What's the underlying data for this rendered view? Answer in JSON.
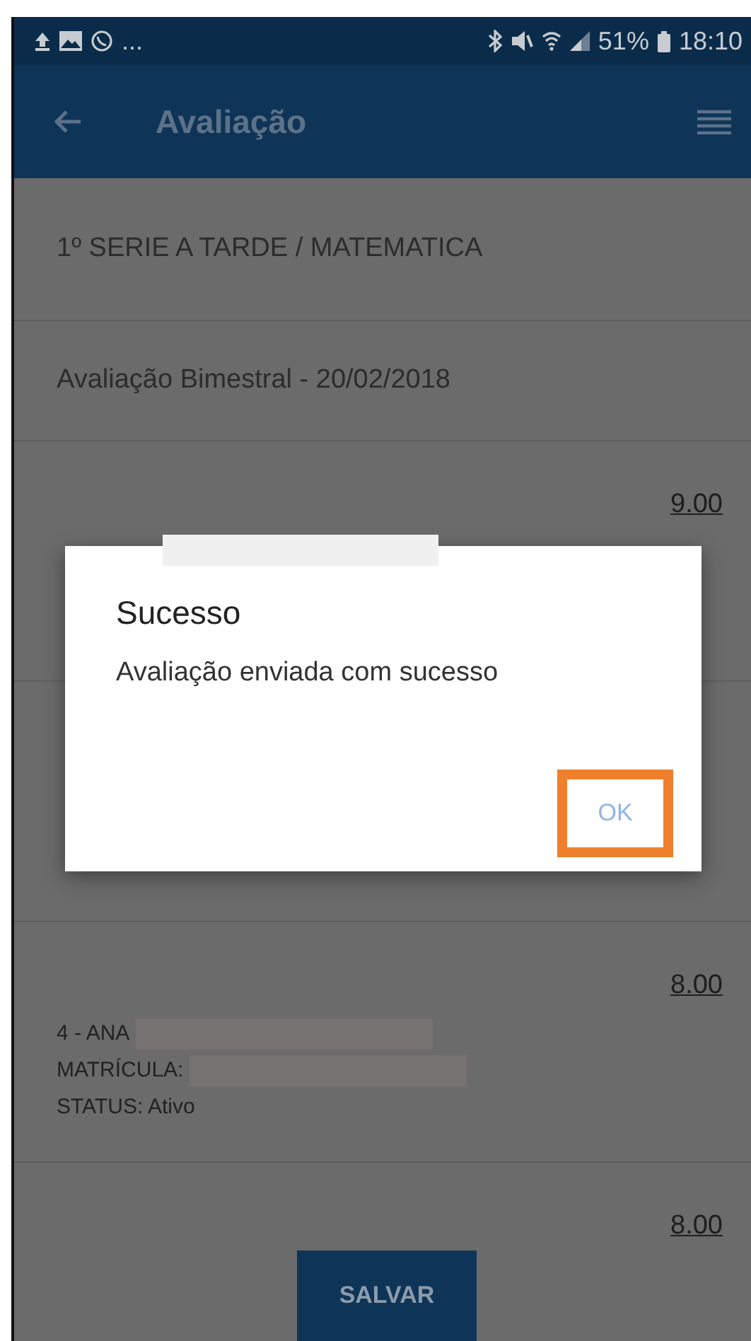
{
  "status_bar": {
    "notifications": "...",
    "battery": "51%",
    "time": "18:10"
  },
  "app_bar": {
    "title": "Avaliação"
  },
  "class_heading": "1º SERIE A  TARDE / MATEMATICA",
  "assessment_heading": "Avaliação Bimestral  - 20/02/2018",
  "students": [
    {
      "grade": "9.00"
    },
    {
      "grade": "8.00",
      "name": "4 - ANA",
      "registration": "MATRÍCULA:",
      "status": "STATUS: Ativo"
    },
    {
      "grade": "8.00"
    }
  ],
  "save_button": "SALVAR",
  "dialog": {
    "title": "Sucesso",
    "message": "Avaliação enviada com sucesso",
    "button": "OK",
    "highlighted": true
  }
}
